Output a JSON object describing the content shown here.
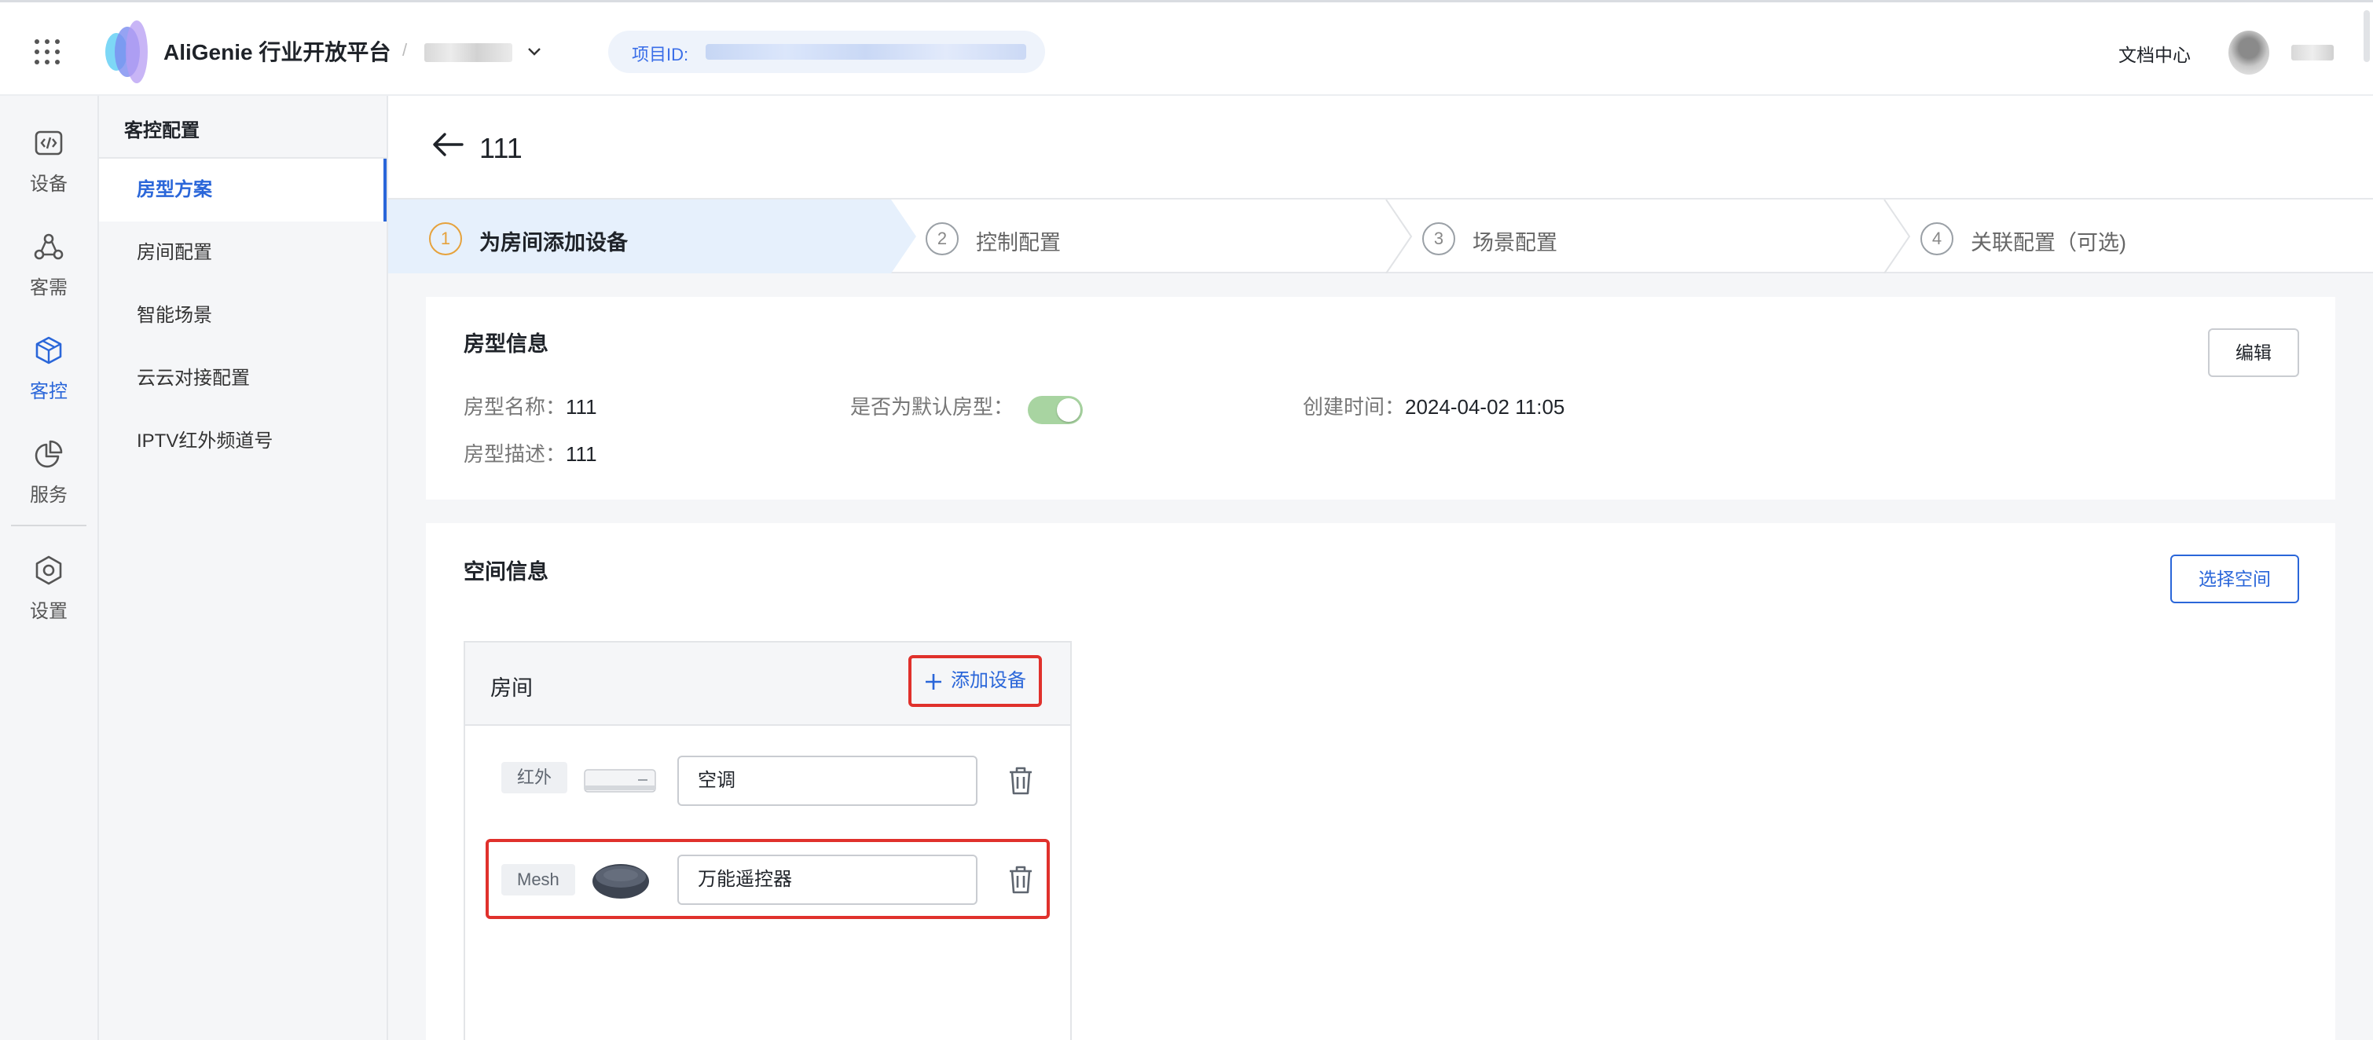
{
  "header": {
    "brand": "AliGenie 行业开放平台",
    "crumb_separator": "/",
    "project_id_label": "项目ID:",
    "doc_center": "文档中心"
  },
  "rail": {
    "items": [
      {
        "label": "设备",
        "icon": "code-icon"
      },
      {
        "label": "客需",
        "icon": "nodes-icon"
      },
      {
        "label": "客控",
        "icon": "cube-icon",
        "active": true
      },
      {
        "label": "服务",
        "icon": "pie-chart-icon"
      },
      {
        "label": "设置",
        "icon": "settings-hex-icon"
      }
    ]
  },
  "subnav": {
    "title": "客控配置",
    "items": [
      {
        "label": "房型方案",
        "active": true
      },
      {
        "label": "房间配置"
      },
      {
        "label": "智能场景"
      },
      {
        "label": "云云对接配置"
      },
      {
        "label": "IPTV红外频道号"
      }
    ]
  },
  "page": {
    "title": "111",
    "steps": [
      {
        "num": "1",
        "label": "为房间添加设备",
        "active": true
      },
      {
        "num": "2",
        "label": "控制配置"
      },
      {
        "num": "3",
        "label": "场景配置"
      },
      {
        "num": "4",
        "label": "关联配置（可选)"
      }
    ]
  },
  "room_type": {
    "title": "房型信息",
    "edit_button": "编辑",
    "name_key": "房型名称：",
    "name_val": "111",
    "default_key": "是否为默认房型：",
    "default_on": true,
    "created_key": "创建时间：",
    "created_val": "2024-04-02 11:05",
    "desc_key": "房型描述：",
    "desc_val": "111"
  },
  "space": {
    "title": "空间信息",
    "select_button": "选择空间",
    "room": {
      "title": "房间",
      "add_device": "添加设备",
      "devices": [
        {
          "tag": "红外",
          "name": "空调",
          "image": "air-conditioner"
        },
        {
          "tag": "Mesh",
          "name": "万能遥控器",
          "image": "universal-remote"
        }
      ]
    }
  },
  "colors": {
    "primary": "#2a66d9",
    "highlight_red": "#e0312c",
    "active_step_bg": "#e6f0fc",
    "step_number_active": "#e6a23c",
    "toggle_on": "#a8d4a1"
  }
}
